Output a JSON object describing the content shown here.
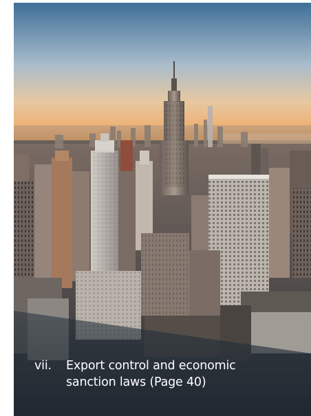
{
  "caption": {
    "numeral": "vii.",
    "line1": "Export control and economic",
    "line2": "sanction laws (Page 40)"
  },
  "image": {
    "subject": "city-skyline-photo"
  },
  "colors": {
    "sky_top": "#3f6f98",
    "sky_mid": "#9fb7c9",
    "horizon": "#f0b064",
    "overlay": "#24313c",
    "text": "#ffffff"
  }
}
